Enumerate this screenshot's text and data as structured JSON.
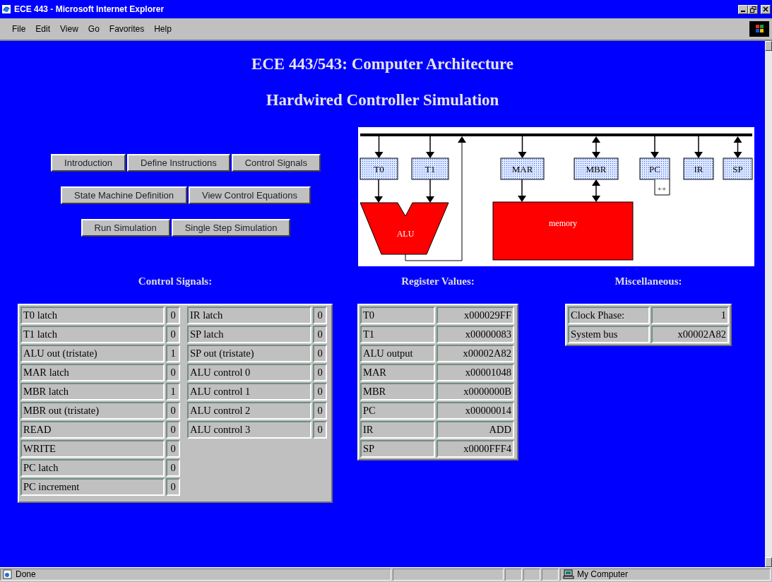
{
  "window": {
    "title": "ECE 443 - Microsoft Internet Explorer"
  },
  "menu": [
    "File",
    "Edit",
    "View",
    "Go",
    "Favorites",
    "Help"
  ],
  "titles": [
    "ECE 443/543: Computer Architecture",
    "Hardwired Controller Simulation"
  ],
  "button_rows": [
    [
      "Introduction",
      "Define Instructions",
      "Control Signals"
    ],
    [
      "State Machine Definition",
      "View Control Equations"
    ],
    [
      "Run Simulation",
      "Single Step Simulation"
    ]
  ],
  "diagram": {
    "registers": [
      {
        "label": "T0",
        "bidirectional": false
      },
      {
        "label": "T1",
        "bidirectional": false
      },
      {
        "label": "MAR",
        "bidirectional": false
      },
      {
        "label": "MBR",
        "bidirectional": true
      },
      {
        "label": "PC",
        "bidirectional": false
      },
      {
        "label": "IR",
        "bidirectional": false
      },
      {
        "label": "SP",
        "bidirectional": true
      }
    ],
    "alu": "ALU",
    "memory": "memory",
    "increment": "++"
  },
  "control_signals": {
    "heading": "Control Signals:",
    "columns": [
      [
        {
          "label": "T0 latch",
          "value": "0"
        },
        {
          "label": "T1 latch",
          "value": "0"
        },
        {
          "label": "ALU out (tristate)",
          "value": "1"
        },
        {
          "label": "MAR latch",
          "value": "0"
        },
        {
          "label": "MBR latch",
          "value": "1"
        },
        {
          "label": "MBR out (tristate)",
          "value": "0"
        },
        {
          "label": "READ",
          "value": "0"
        },
        {
          "label": "WRITE",
          "value": "0"
        },
        {
          "label": "PC latch",
          "value": "0"
        },
        {
          "label": "PC increment",
          "value": "0"
        }
      ],
      [
        {
          "label": "IR latch",
          "value": "0"
        },
        {
          "label": "SP latch",
          "value": "0"
        },
        {
          "label": "SP out (tristate)",
          "value": "0"
        },
        {
          "label": "ALU control 0",
          "value": "0"
        },
        {
          "label": "ALU control 1",
          "value": "0"
        },
        {
          "label": "ALU control 2",
          "value": "0"
        },
        {
          "label": "ALU control 3",
          "value": "0"
        }
      ]
    ]
  },
  "register_values": {
    "heading": "Register Values:",
    "rows": [
      {
        "label": "T0",
        "value": "x000029FF"
      },
      {
        "label": "T1",
        "value": "x00000083"
      },
      {
        "label": "ALU output",
        "value": "x00002A82"
      },
      {
        "label": "MAR",
        "value": "x00001048"
      },
      {
        "label": "MBR",
        "value": "x0000000B"
      },
      {
        "label": "PC",
        "value": "x00000014"
      },
      {
        "label": "IR",
        "value": "ADD"
      },
      {
        "label": "SP",
        "value": "x0000FFF4"
      }
    ]
  },
  "miscellaneous": {
    "heading": "Miscellaneous:",
    "rows": [
      {
        "label": "Clock Phase:",
        "value": "1"
      },
      {
        "label": "System bus",
        "value": "x00002A82"
      }
    ]
  },
  "status_bar": {
    "text": "Done",
    "zone": "My Computer"
  }
}
